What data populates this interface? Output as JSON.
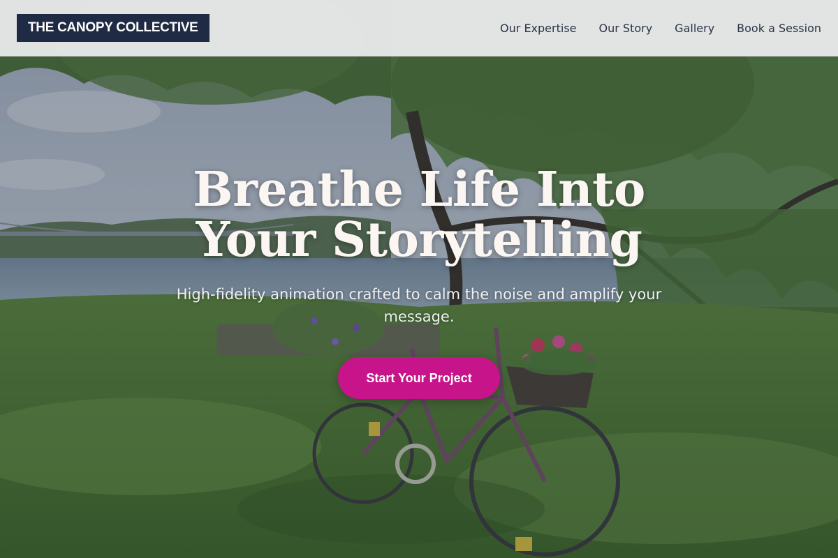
{
  "header": {
    "logo_text": "THE CANOPY COLLECTIVE",
    "nav": [
      {
        "label": "Our Expertise"
      },
      {
        "label": "Our Story"
      },
      {
        "label": "Gallery"
      },
      {
        "label": "Book a Session"
      }
    ]
  },
  "hero": {
    "headline": "Breathe Life Into Your Storytelling",
    "subheadline": "High-fidelity animation crafted to calm the noise and amplify your message.",
    "cta_label": "Start Your Project",
    "background_image": "bicycle-by-river-photo"
  },
  "colors": {
    "logo_bg": "#1f2a44",
    "cta_bg": "#c8148b",
    "header_bg": "#eeeef0",
    "nav_text": "#2b3346"
  }
}
